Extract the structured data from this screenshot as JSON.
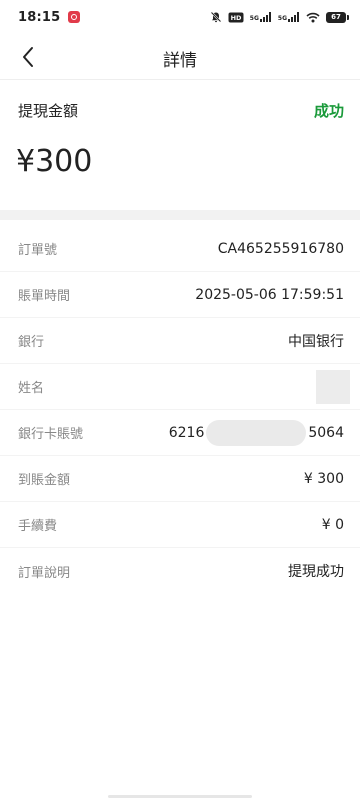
{
  "status_bar": {
    "time": "18:15",
    "network_1": "5G",
    "network_2": "5G",
    "battery": "67"
  },
  "header": {
    "title": "詳情",
    "back_icon": "chevron-left-icon"
  },
  "summary": {
    "label": "提現金額",
    "status": "成功",
    "status_color": "#1a9a3a",
    "amount": "¥300"
  },
  "details": [
    {
      "label": "訂單號",
      "value": "CA465255916780"
    },
    {
      "label": "賬單時間",
      "value": "2025-05-06 17:59:51"
    },
    {
      "label": "銀行",
      "value": "中国银行"
    },
    {
      "label": "姓名",
      "value": ""
    },
    {
      "label": "銀行卡賬號",
      "value_prefix": "6216",
      "value_suffix": "5064"
    },
    {
      "label": "到賬金額",
      "value": "¥ 300"
    },
    {
      "label": "手續費",
      "value": "¥ 0"
    },
    {
      "label": "訂單說明",
      "value": "提現成功"
    }
  ]
}
